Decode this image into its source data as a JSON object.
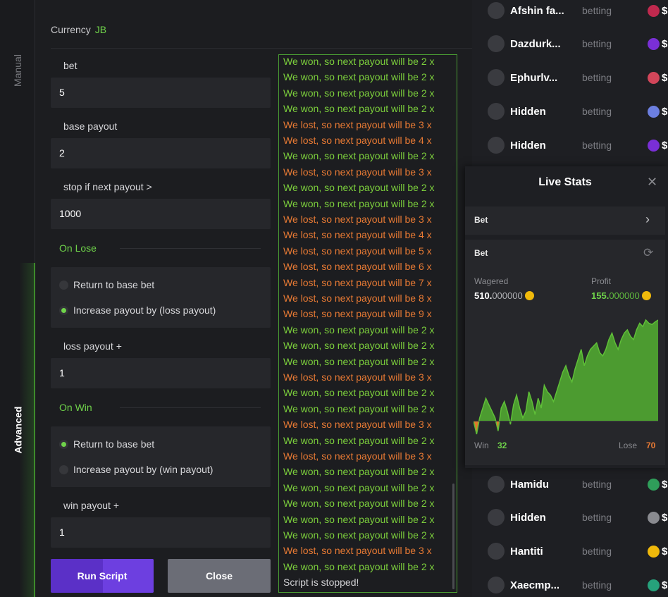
{
  "tabs": {
    "manual": "Manual",
    "advanced": "Advanced"
  },
  "form": {
    "currency_label": "Currency",
    "currency_value": "JB",
    "bet_label": "bet",
    "bet_value": "5",
    "base_payout_label": "base payout",
    "base_payout_value": "2",
    "stop_label": "stop if next payout >",
    "stop_value": "1000",
    "on_lose_title": "On Lose",
    "on_lose_options": [
      "Return to base bet",
      "Increase payout by (loss payout)"
    ],
    "on_lose_selected": 1,
    "loss_payout_label": "loss payout +",
    "loss_payout_value": "1",
    "on_win_title": "On Win",
    "on_win_options": [
      "Return to base bet",
      "Increase payout by (win payout)"
    ],
    "on_win_selected": 0,
    "win_payout_label": "win payout +",
    "win_payout_value": "1",
    "run_label": "Run Script",
    "close_label": "Close"
  },
  "console": {
    "lines": [
      {
        "text": "We won, so next payout will be 2 x",
        "type": "won"
      },
      {
        "text": "We won, so next payout will be 2 x",
        "type": "won"
      },
      {
        "text": "We won, so next payout will be 2 x",
        "type": "won"
      },
      {
        "text": "We won, so next payout will be 2 x",
        "type": "won"
      },
      {
        "text": "We lost, so next payout will be 3 x",
        "type": "lost"
      },
      {
        "text": "We lost, so next payout will be 4 x",
        "type": "lost"
      },
      {
        "text": "We won, so next payout will be 2 x",
        "type": "won"
      },
      {
        "text": "We lost, so next payout will be 3 x",
        "type": "lost"
      },
      {
        "text": "We won, so next payout will be 2 x",
        "type": "won"
      },
      {
        "text": "We won, so next payout will be 2 x",
        "type": "won"
      },
      {
        "text": "We lost, so next payout will be 3 x",
        "type": "lost"
      },
      {
        "text": "We lost, so next payout will be 4 x",
        "type": "lost"
      },
      {
        "text": "We lost, so next payout will be 5 x",
        "type": "lost"
      },
      {
        "text": "We lost, so next payout will be 6 x",
        "type": "lost"
      },
      {
        "text": "We lost, so next payout will be 7 x",
        "type": "lost"
      },
      {
        "text": "We lost, so next payout will be 8 x",
        "type": "lost"
      },
      {
        "text": "We lost, so next payout will be 9 x",
        "type": "lost"
      },
      {
        "text": "We won, so next payout will be 2 x",
        "type": "won"
      },
      {
        "text": "We won, so next payout will be 2 x",
        "type": "won"
      },
      {
        "text": "We won, so next payout will be 2 x",
        "type": "won"
      },
      {
        "text": "We lost, so next payout will be 3 x",
        "type": "lost"
      },
      {
        "text": "We won, so next payout will be 2 x",
        "type": "won"
      },
      {
        "text": "We won, so next payout will be 2 x",
        "type": "won"
      },
      {
        "text": "We lost, so next payout will be 3 x",
        "type": "lost"
      },
      {
        "text": "We won, so next payout will be 2 x",
        "type": "won"
      },
      {
        "text": "We lost, so next payout will be 3 x",
        "type": "lost"
      },
      {
        "text": "We won, so next payout will be 2 x",
        "type": "won"
      },
      {
        "text": "We won, so next payout will be 2 x",
        "type": "won"
      },
      {
        "text": "We won, so next payout will be 2 x",
        "type": "won"
      },
      {
        "text": "We won, so next payout will be 2 x",
        "type": "won"
      },
      {
        "text": "We won, so next payout will be 2 x",
        "type": "won"
      },
      {
        "text": "We lost, so next payout will be 3 x",
        "type": "lost"
      },
      {
        "text": "We won, so next payout will be 2 x",
        "type": "won"
      },
      {
        "text": "Script is stopped!",
        "type": "stop"
      }
    ]
  },
  "players": [
    {
      "name": "Afshin fa...",
      "status": "betting",
      "coin": "#c0294e",
      "amount": "$"
    },
    {
      "name": "Dazdurk...",
      "status": "betting",
      "coin": "#7a2fd6",
      "amount": "$"
    },
    {
      "name": "Ephurlv...",
      "status": "betting",
      "coin": "#d2465a",
      "amount": "$"
    },
    {
      "name": "Hidden",
      "status": "betting",
      "coin": "#6c7fe0",
      "amount": "$"
    },
    {
      "name": "Hidden",
      "status": "betting",
      "coin": "#7a2fd6",
      "amount": "$"
    },
    {
      "name": "Hamidu",
      "status": "betting",
      "coin": "#2f9e5a",
      "amount": "$"
    },
    {
      "name": "Hidden",
      "status": "betting",
      "coin": "#8a8b90",
      "amount": "$"
    },
    {
      "name": "Hantiti",
      "status": "betting",
      "coin": "#f0b90b",
      "amount": "$"
    },
    {
      "name": "Xaecmp...",
      "status": "betting",
      "coin": "#26a17b",
      "amount": "$"
    }
  ],
  "live_stats": {
    "title": "Live Stats",
    "bet_row_label": "Bet",
    "card_label": "Bet",
    "wagered_label": "Wagered",
    "wagered_int": "510.",
    "wagered_dec": "000000",
    "profit_label": "Profit",
    "profit_int": "155.",
    "profit_dec": "000000",
    "win_label": "Win",
    "win_value": "32",
    "lose_label": "Lose",
    "lose_value": "70",
    "colors": {
      "profit": "#4c9b30",
      "loss": "#e07a2a",
      "coin": "#f0b90b"
    },
    "chart_data": {
      "type": "area",
      "x": [
        0,
        1,
        2,
        3,
        4,
        5,
        6,
        7,
        8,
        9,
        10,
        11,
        12,
        13,
        14,
        15,
        16,
        17,
        18,
        19,
        20,
        21,
        22,
        23,
        24,
        25,
        26,
        27,
        28,
        29,
        30,
        31,
        32,
        33,
        34,
        35,
        36,
        37,
        38,
        39,
        40,
        41,
        42,
        43,
        44,
        45,
        46,
        47,
        48,
        49,
        50,
        51,
        52,
        53,
        54,
        55,
        56,
        57,
        58,
        59,
        60
      ],
      "values": [
        0,
        -20,
        5,
        20,
        35,
        25,
        15,
        5,
        -15,
        20,
        30,
        15,
        -5,
        25,
        40,
        20,
        5,
        15,
        45,
        30,
        10,
        35,
        20,
        55,
        45,
        40,
        30,
        45,
        60,
        75,
        85,
        70,
        60,
        80,
        95,
        110,
        85,
        100,
        110,
        115,
        120,
        105,
        100,
        110,
        125,
        135,
        120,
        110,
        125,
        135,
        140,
        130,
        125,
        140,
        150,
        145,
        155,
        150,
        148,
        152,
        155
      ],
      "baseline": 0
    }
  }
}
